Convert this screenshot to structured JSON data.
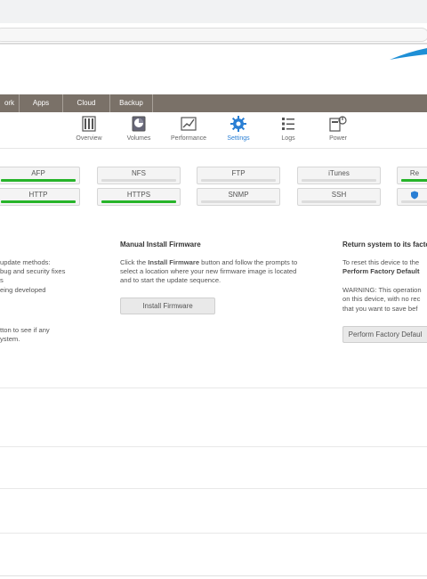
{
  "nav": {
    "tabs": [
      "ork",
      "Apps",
      "Cloud",
      "Backup"
    ]
  },
  "iconbar": {
    "items": [
      {
        "label": "Overview",
        "icon": "overview-icon"
      },
      {
        "label": "Volumes",
        "icon": "volumes-icon"
      },
      {
        "label": "Performance",
        "icon": "performance-icon"
      },
      {
        "label": "Settings",
        "icon": "gear-icon",
        "active": true
      },
      {
        "label": "Logs",
        "icon": "logs-icon"
      },
      {
        "label": "Power",
        "icon": "power-icon"
      }
    ]
  },
  "services": {
    "row1": [
      {
        "label": "AFP",
        "enabled": true
      },
      {
        "label": "NFS",
        "enabled": false
      },
      {
        "label": "FTP",
        "enabled": false
      },
      {
        "label": "iTunes",
        "enabled": false
      },
      {
        "label": "Re",
        "enabled": true
      }
    ],
    "row2": [
      {
        "label": "HTTP",
        "enabled": true
      },
      {
        "label": "HTTPS",
        "enabled": true
      },
      {
        "label": "SNMP",
        "enabled": false
      },
      {
        "label": "SSH",
        "enabled": false
      },
      {
        "label": "",
        "enabled": false,
        "icon": "shield-icon"
      }
    ]
  },
  "firmware_left": {
    "lines": [
      "update methods:",
      "bug and security fixes",
      "s",
      "eing developed",
      "tton to see if any",
      "ystem."
    ]
  },
  "manual_install": {
    "title": "Manual Install Firmware",
    "p1": "Click the ",
    "p1_bold": "Install Firmware",
    "p1_rest": " button and follow the prompts to",
    "p2": "select a location where your new firmware image is located",
    "p3": "and to start the update sequence.",
    "button": "Install Firmware"
  },
  "factory_default": {
    "title": "Return system to its facto",
    "p1": "To reset this device to the",
    "p2_bold": "Perform Factory Default",
    "warn1": "WARNING: This operation",
    "warn2": "on this device, with no rec",
    "warn3": "that you want to save bef",
    "button": "Perform Factory Defaul"
  },
  "colors": {
    "navbar": "#7a7168",
    "active": "#2a7fd4",
    "enabled_bar": "#27b42a",
    "brand_accent": "#1e8fd6"
  }
}
